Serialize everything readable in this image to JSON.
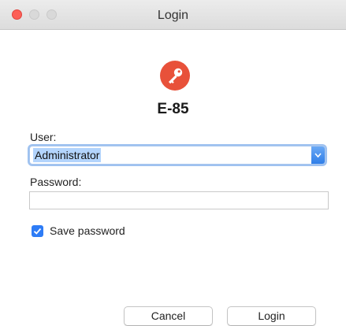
{
  "window": {
    "title": "Login"
  },
  "app": {
    "name": "E-85",
    "icon": "key-icon",
    "icon_color": "#e8513a"
  },
  "form": {
    "user_label": "User:",
    "user_value": "Administrator",
    "password_label": "Password:",
    "password_value": "",
    "save_password_label": "Save password",
    "save_password_checked": true
  },
  "buttons": {
    "cancel_label": "Cancel",
    "login_label": "Login"
  },
  "colors": {
    "accent": "#2e7cf6",
    "close_button": "#fc5f57"
  }
}
